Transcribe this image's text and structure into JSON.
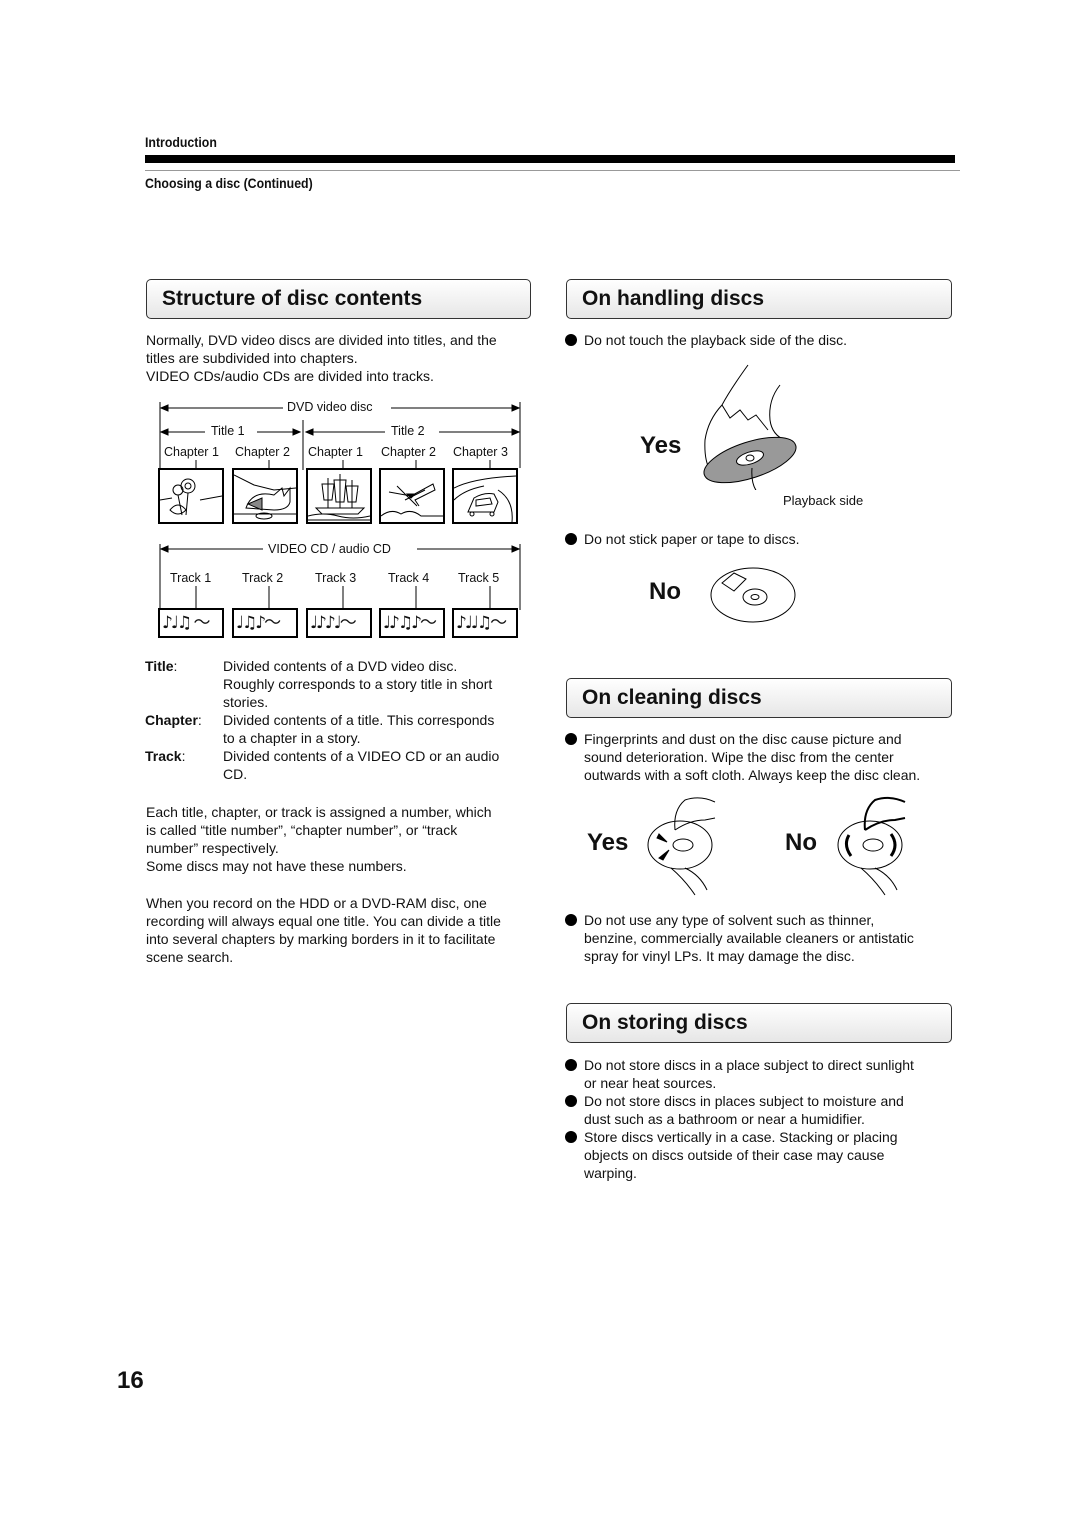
{
  "header": {
    "section": "Introduction",
    "subsection": "Choosing a disc (Continued)"
  },
  "structure": {
    "title": "Structure of disc contents",
    "intro_line1": "Normally, DVD video discs are divided into titles, and the",
    "intro_line2": "titles are subdivided into chapters.",
    "intro_line3": "VIDEO CDs/audio CDs are divided into tracks.",
    "dvd_diagram": {
      "disc_label": "DVD video disc",
      "titles": [
        "Title 1",
        "Title 2"
      ],
      "chapters": [
        "Chapter 1",
        "Chapter 2",
        "Chapter 1",
        "Chapter 2",
        "Chapter 3"
      ],
      "thumbnails": [
        "sunflower-illustration",
        "cat-illustration",
        "ship-illustration",
        "airplane-illustration",
        "car-illustration"
      ]
    },
    "cd_diagram": {
      "disc_label": "VIDEO CD / audio CD",
      "tracks": [
        "Track 1",
        "Track 2",
        "Track 3",
        "Track 4",
        "Track 5"
      ],
      "music_glyphs": [
        "♪♩♫ ～",
        "♩♫♪～",
        "♩♪♪♩～",
        "♩♪♫♪～",
        "♪♩♩♫～"
      ]
    },
    "definitions": [
      {
        "term": "Title",
        "lines": [
          "Divided contents of a DVD video disc.",
          "Roughly corresponds to a story title in short",
          "stories."
        ]
      },
      {
        "term": "Chapter",
        "lines": [
          "Divided contents of a title. This corresponds",
          "to a chapter in a story."
        ]
      },
      {
        "term": "Track",
        "lines": [
          "Divided contents of a VIDEO CD or an audio",
          "CD."
        ]
      }
    ],
    "para2_line1": "Each title, chapter, or track is assigned a number, which",
    "para2_line2": "is called “title number”, “chapter number”, or “track",
    "para2_line3": "number” respectively.",
    "para2_line4": "Some discs may not have these numbers.",
    "para3_line1": "When you record on the HDD or a DVD-RAM disc, one",
    "para3_line2": "recording will always equal one title. You can divide a title",
    "para3_line3": "into several chapters by marking borders in it to facilitate",
    "para3_line4": "scene search."
  },
  "handling": {
    "title": "On handling discs",
    "bullet1": "Do not touch the playback side of the disc.",
    "yes_label": "Yes",
    "playback_side_label": "Playback side",
    "bullet2": "Do not stick paper or tape to discs.",
    "no_label": "No"
  },
  "cleaning": {
    "title": "On cleaning discs",
    "bullet1_line1": "Fingerprints and dust on the disc cause picture and",
    "bullet1_line2": "sound deterioration. Wipe the disc from the center",
    "bullet1_line3": "outwards with a soft cloth. Always keep the disc clean.",
    "yes_label": "Yes",
    "no_label": "No",
    "bullet2_line1": "Do not use any type of solvent such as thinner,",
    "bullet2_line2": "benzine, commercially available cleaners or antistatic",
    "bullet2_line3": "spray for vinyl LPs. It may damage the disc."
  },
  "storing": {
    "title": "On storing discs",
    "bullets": [
      [
        "Do not store discs in a place subject to direct sunlight",
        "or near heat sources."
      ],
      [
        "Do not store discs in places subject to moisture and",
        "dust such as a bathroom or near a humidifier."
      ],
      [
        "Store discs vertically in a case. Stacking or placing",
        "objects on discs outside of their case may cause",
        "warping."
      ]
    ]
  },
  "page_number": "16"
}
